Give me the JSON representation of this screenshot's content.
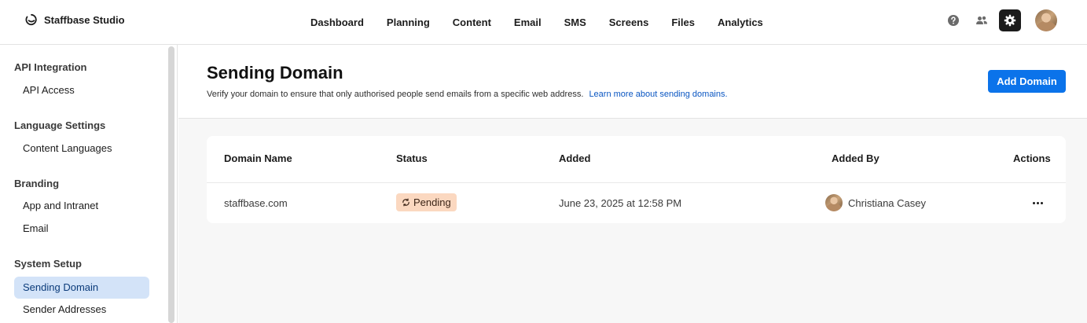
{
  "app": {
    "name": "Staffbase Studio"
  },
  "nav": [
    "Dashboard",
    "Planning",
    "Content",
    "Email",
    "SMS",
    "Screens",
    "Files",
    "Analytics"
  ],
  "top_icons": [
    "help-icon",
    "people-icon",
    "gear-icon",
    "user-avatar"
  ],
  "sidebar": {
    "sections": [
      {
        "title": "API Integration",
        "items": [
          "API Access"
        ]
      },
      {
        "title": "Language Settings",
        "items": [
          "Content Languages"
        ]
      },
      {
        "title": "Branding",
        "items": [
          "App and Intranet",
          "Email"
        ]
      },
      {
        "title": "System Setup",
        "items": [
          "Sending Domain",
          "Sender Addresses"
        ]
      }
    ],
    "active_item": "Sending Domain"
  },
  "page": {
    "title": "Sending Domain",
    "description": "Verify your domain to ensure that only authorised people send emails from a specific web address.",
    "link": "Learn more about sending domains.",
    "add_button": "Add Domain"
  },
  "table": {
    "columns": [
      "Domain Name",
      "Status",
      "Added",
      "Added By",
      "Actions"
    ],
    "rows": [
      {
        "domain": "staffbase.com",
        "status": "Pending",
        "added": "June 23, 2025 at 12:58 PM",
        "added_by": "Christiana Casey"
      }
    ]
  },
  "colors": {
    "primary": "#0b73ea",
    "pending_badge": "#fbd8c0",
    "active_item": "#d3e3f8",
    "link": "#0a56c2"
  }
}
